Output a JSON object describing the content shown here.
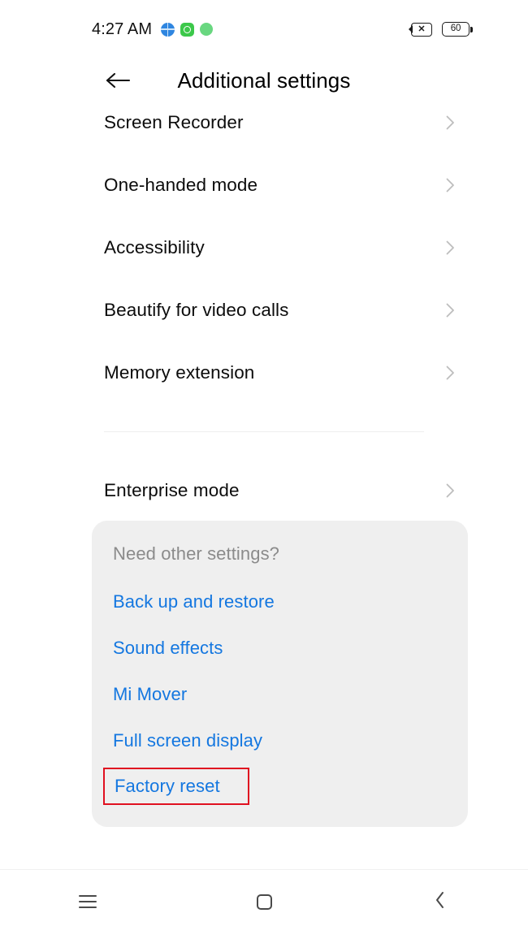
{
  "status_bar": {
    "time": "4:27 AM",
    "notification_icons": [
      "globe-icon",
      "green-app-icon",
      "green-dot-icon"
    ],
    "mute_icon_label": "✕",
    "battery_level": "60",
    "right_icons": [
      "mute-icon",
      "battery-icon"
    ]
  },
  "app_bar": {
    "back_icon": "back-arrow-icon",
    "title": "Additional settings"
  },
  "settings_list": [
    {
      "label": "Screen Recorder",
      "chevron": "chevron-right-icon"
    },
    {
      "label": "One-handed mode",
      "chevron": "chevron-right-icon"
    },
    {
      "label": "Accessibility",
      "chevron": "chevron-right-icon"
    },
    {
      "label": "Beautify for video calls",
      "chevron": "chevron-right-icon"
    },
    {
      "label": "Memory extension",
      "chevron": "chevron-right-icon"
    },
    {
      "label": "Enterprise mode",
      "chevron": "chevron-right-icon"
    }
  ],
  "other_settings_card": {
    "heading": "Need other settings?",
    "links": [
      {
        "label": "Back up and restore",
        "highlighted": false
      },
      {
        "label": "Sound effects",
        "highlighted": false
      },
      {
        "label": "Mi Mover",
        "highlighted": false
      },
      {
        "label": "Full screen display",
        "highlighted": false
      },
      {
        "label": "Factory reset",
        "highlighted": true
      }
    ]
  },
  "nav_bar": {
    "recents_label": "recents-icon",
    "home_label": "home-icon",
    "back_label": "back-icon"
  },
  "colors": {
    "link_blue": "#1477e0",
    "card_bg": "#efefef",
    "heading_gray": "#8b8b8b",
    "highlight_red": "#e01020",
    "text_black": "#0c0c0c"
  }
}
